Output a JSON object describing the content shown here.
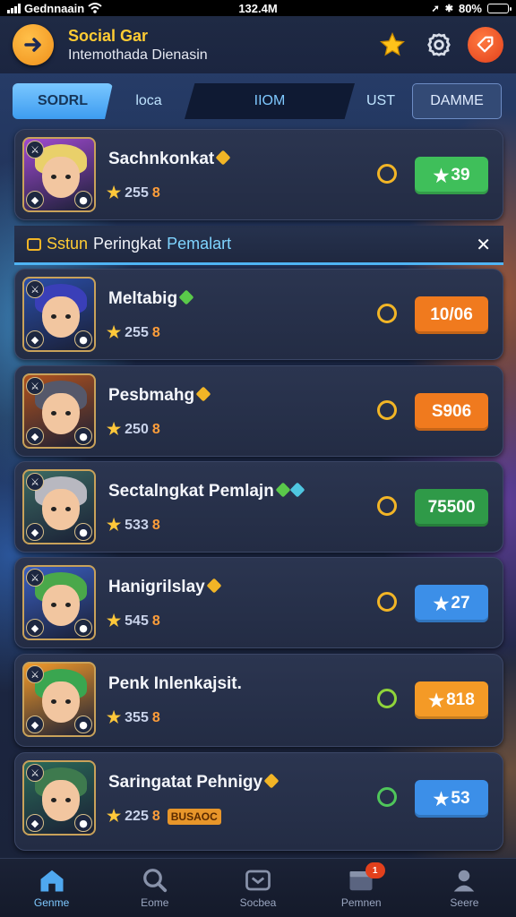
{
  "status_bar": {
    "carrier": "Gednnaain",
    "time": "132.4M",
    "battery_label": "80%"
  },
  "header": {
    "title": "Social Gar",
    "subtitle": "Intemothada Dienasin"
  },
  "tabs": [
    {
      "label": "SODRL",
      "active": true
    },
    {
      "label": "loca"
    },
    {
      "label": "IIOM"
    },
    {
      "label": "UST"
    },
    {
      "label": "DAMME"
    }
  ],
  "ranking_bar": {
    "word1": "Sstun",
    "word2": "Peringkat",
    "word3": "Pemalart"
  },
  "players": [
    {
      "name": "Sachnkonkat",
      "stars": "255",
      "suffix": "8",
      "score": "39",
      "score_color": "#3fbf5a",
      "score_icon": "star",
      "check_color": "#f2b526",
      "gem_colors": [
        "#f2b526"
      ],
      "hair": "#e9d06a",
      "bg": "#a04ad0",
      "tag": ""
    },
    {
      "name": "Meltabig",
      "stars": "255",
      "suffix": "8",
      "score": "10/06",
      "score_color": "#f07a1e",
      "score_icon": "",
      "check_color": "#f2b526",
      "gem_colors": [
        "#5ac94a"
      ],
      "hair": "#3a3fb8",
      "bg": "#2a4ea8",
      "tag": ""
    },
    {
      "name": "Pesbmahg",
      "stars": "250",
      "suffix": "8",
      "score": "S906",
      "score_color": "#f07a1e",
      "score_icon": "",
      "check_color": "#f2b526",
      "gem_colors": [
        "#f2b526"
      ],
      "hair": "#55586a",
      "bg": "#b0521e",
      "tag": ""
    },
    {
      "name": "Sectalngkat Pemlajn",
      "stars": "533",
      "suffix": "8",
      "score": "75500",
      "score_color": "#2f9a48",
      "score_icon": "",
      "check_color": "#f2b526",
      "gem_colors": [
        "#5ac94a",
        "#4fc6e0"
      ],
      "hair": "#b8b8c0",
      "bg": "#3b6a62",
      "tag": ""
    },
    {
      "name": "Hanigrilslay",
      "stars": "545",
      "suffix": "8",
      "score": "27",
      "score_color": "#3c8fe8",
      "score_icon": "star",
      "check_color": "#f2b526",
      "gem_colors": [
        "#f2b526"
      ],
      "hair": "#4aa84a",
      "bg": "#3a5fc0",
      "tag": ""
    },
    {
      "name": "Penk Inlenkajsit.",
      "stars": "355",
      "suffix": "8",
      "score": "818",
      "score_color": "#f49a26",
      "score_icon": "star",
      "check_color": "#8fd43a",
      "gem_colors": [],
      "hair": "#3aa650",
      "bg": "#f29a2a",
      "tag": ""
    },
    {
      "name": "Saringatat Pehnigy",
      "stars": "225",
      "suffix": "8",
      "score": "53",
      "score_color": "#3c8fe8",
      "score_icon": "star",
      "check_color": "#4fc65a",
      "gem_colors": [
        "#f2b526"
      ],
      "hair": "#3e7a4e",
      "bg": "#2a6a58",
      "tag": "BUSAOC"
    }
  ],
  "bottom_nav": [
    {
      "label": "Genme",
      "active": true,
      "icon": "home-icon"
    },
    {
      "label": "Eome",
      "icon": "search-icon"
    },
    {
      "label": "Socbea",
      "icon": "chat-icon"
    },
    {
      "label": "Pemnen",
      "icon": "store-icon",
      "badge": "1"
    },
    {
      "label": "Seere",
      "icon": "profile-icon"
    }
  ]
}
